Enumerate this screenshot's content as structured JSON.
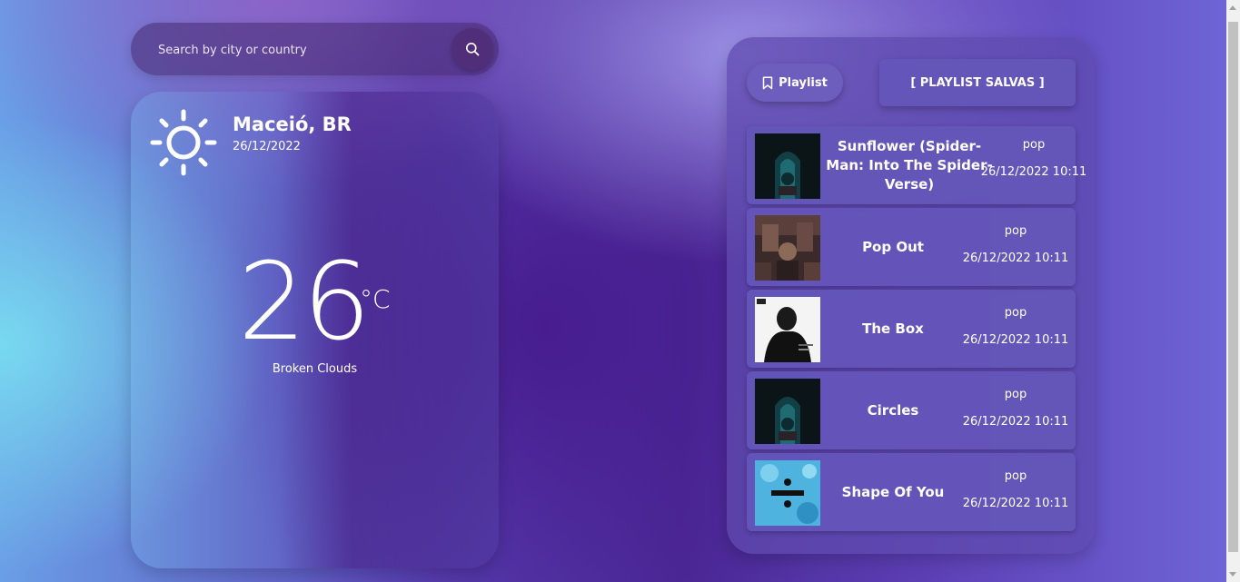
{
  "search": {
    "placeholder": "Search by city or country"
  },
  "weather": {
    "icon": "sun-icon",
    "city": "Maceió, BR",
    "date": "26/12/2022",
    "temperature": "26",
    "unit": "°C",
    "condition": "Broken Clouds"
  },
  "playlist": {
    "playlist_button": "Playlist",
    "saved_button": "[ PLAYLIST SALVAS ]",
    "tracks": [
      {
        "title": "Sunflower (Spider-Man: Into The Spider-Verse)",
        "genre": "pop",
        "datetime": "26/12/2022 10:11"
      },
      {
        "title": "Pop Out",
        "genre": "pop",
        "datetime": "26/12/2022 10:11"
      },
      {
        "title": "The Box",
        "genre": "pop",
        "datetime": "26/12/2022 10:11"
      },
      {
        "title": "Circles",
        "genre": "pop",
        "datetime": "26/12/2022 10:11"
      },
      {
        "title": "Shape Of You",
        "genre": "pop",
        "datetime": "26/12/2022 10:11"
      }
    ]
  }
}
